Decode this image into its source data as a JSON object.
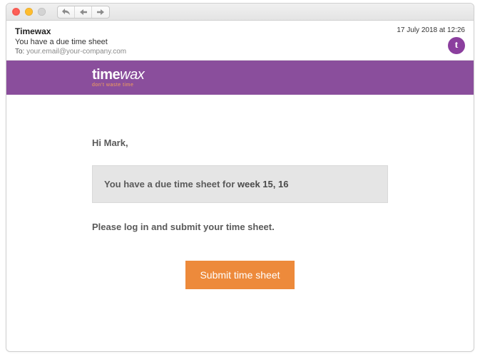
{
  "titlebar": {},
  "header": {
    "from": "Timewax",
    "subject": "You have a due time sheet",
    "to_label": "To:",
    "to_address": "your.email@your-company.com",
    "date": "17 July 2018 at 12:26",
    "avatar_letter": "t"
  },
  "brand": {
    "name_prefix": "time",
    "name_suffix": "wax",
    "tagline": "don't waste time"
  },
  "email": {
    "greeting": "Hi Mark,",
    "notice_prefix": "You have a due time sheet for ",
    "notice_weeks": "week 15, 16",
    "instruction": "Please log in and submit your time sheet.",
    "cta": "Submit time sheet"
  }
}
